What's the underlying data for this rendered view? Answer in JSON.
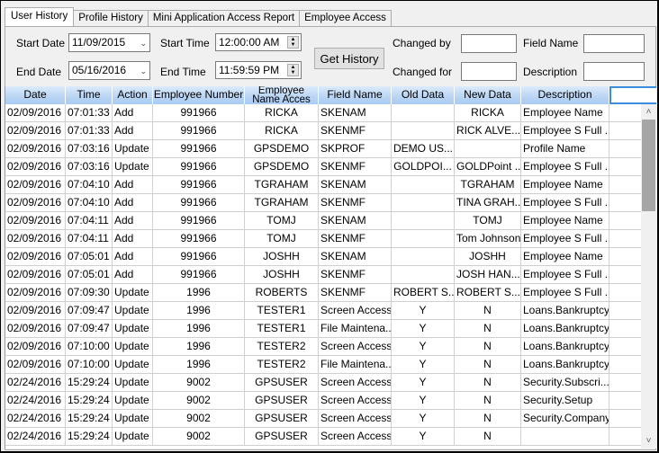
{
  "tabs": [
    {
      "label": "User History",
      "active": true
    },
    {
      "label": "Profile History",
      "active": false
    },
    {
      "label": "Mini Application Access Report",
      "active": false
    },
    {
      "label": "Employee Access",
      "active": false
    }
  ],
  "filters": {
    "start_date_label": "Start Date",
    "start_date_value": "11/09/2015",
    "end_date_label": "End Date",
    "end_date_value": "05/16/2016",
    "start_time_label": "Start Time",
    "start_time_value": "12:00:00 AM",
    "end_time_label": "End Time",
    "end_time_value": "11:59:59 PM",
    "get_history_label": "Get History",
    "changed_by_label": "Changed by",
    "changed_by_value": "",
    "changed_for_label": "Changed for",
    "changed_for_value": "",
    "field_name_label": "Field Name",
    "field_name_value": "",
    "description_label": "Description",
    "description_value": ""
  },
  "icons": {
    "dropdown": "chevron-down-icon",
    "spin": "spin-updown-icon",
    "scroll_up": "chevron-up-icon",
    "scroll_down": "chevron-down-icon"
  },
  "grid": {
    "columns": [
      "Date",
      "Time",
      "Action",
      "Employee Number",
      "Employee Name Acces",
      "Field Name",
      "Old Data",
      "New Data",
      "Description",
      ""
    ],
    "employee_name_header_line1": "Employee",
    "employee_name_header_line2": "Name  Acces",
    "rows": [
      [
        "02/09/2016",
        "07:01:33",
        "Add",
        "991966",
        "RICKA",
        "SKENAM",
        "",
        "RICKA",
        "Employee Name"
      ],
      [
        "02/09/2016",
        "07:01:33",
        "Add",
        "991966",
        "RICKA",
        "SKENMF",
        "",
        "RICK ALVE...",
        "Employee S Full ..."
      ],
      [
        "02/09/2016",
        "07:03:16",
        "Update",
        "991966",
        "GPSDEMO",
        "SKPROF",
        "DEMO US...",
        "",
        "Profile Name"
      ],
      [
        "02/09/2016",
        "07:03:16",
        "Update",
        "991966",
        "GPSDEMO",
        "SKENMF",
        "GOLDPOI...",
        "GOLDPoint ...",
        "Employee S Full ..."
      ],
      [
        "02/09/2016",
        "07:04:10",
        "Add",
        "991966",
        "TGRAHAM",
        "SKENAM",
        "",
        "TGRAHAM",
        "Employee Name"
      ],
      [
        "02/09/2016",
        "07:04:10",
        "Add",
        "991966",
        "TGRAHAM",
        "SKENMF",
        "",
        "TINA GRAH...",
        "Employee S Full ..."
      ],
      [
        "02/09/2016",
        "07:04:11",
        "Add",
        "991966",
        "TOMJ",
        "SKENAM",
        "",
        "TOMJ",
        "Employee Name"
      ],
      [
        "02/09/2016",
        "07:04:11",
        "Add",
        "991966",
        "TOMJ",
        "SKENMF",
        "",
        "Tom Johnson",
        "Employee S Full ..."
      ],
      [
        "02/09/2016",
        "07:05:01",
        "Add",
        "991966",
        "JOSHH",
        "SKENAM",
        "",
        "JOSHH",
        "Employee Name"
      ],
      [
        "02/09/2016",
        "07:05:01",
        "Add",
        "991966",
        "JOSHH",
        "SKENMF",
        "",
        "JOSH HAN...",
        "Employee S Full ..."
      ],
      [
        "02/09/2016",
        "07:09:30",
        "Update",
        "1996",
        "ROBERTS",
        "SKENMF",
        "ROBERT S...",
        "ROBERT S...",
        "Employee S Full ..."
      ],
      [
        "02/09/2016",
        "07:09:47",
        "Update",
        "1996",
        "TESTER1",
        "Screen Access",
        "Y",
        "N",
        "Loans.Bankruptcy"
      ],
      [
        "02/09/2016",
        "07:09:47",
        "Update",
        "1996",
        "TESTER1",
        "File Maintena...",
        "Y",
        "N",
        "Loans.Bankruptcy"
      ],
      [
        "02/09/2016",
        "07:10:00",
        "Update",
        "1996",
        "TESTER2",
        "Screen Access",
        "Y",
        "N",
        "Loans.Bankruptcy"
      ],
      [
        "02/09/2016",
        "07:10:00",
        "Update",
        "1996",
        "TESTER2",
        "File Maintena...",
        "Y",
        "N",
        "Loans.Bankruptcy"
      ],
      [
        "02/24/2016",
        "15:29:24",
        "Update",
        "9002",
        "GPSUSER",
        "Screen Access",
        "Y",
        "N",
        "Security.Subscri..."
      ],
      [
        "02/24/2016",
        "15:29:24",
        "Update",
        "9002",
        "GPSUSER",
        "Screen Access",
        "Y",
        "N",
        "Security.Setup"
      ],
      [
        "02/24/2016",
        "15:29:24",
        "Update",
        "9002",
        "GPSUSER",
        "Screen Access",
        "Y",
        "N",
        "Security.Company"
      ],
      [
        "02/24/2016",
        "15:29:24",
        "Update",
        "9002",
        "GPSUSER",
        "Screen Access",
        "Y",
        "N",
        ""
      ]
    ]
  }
}
